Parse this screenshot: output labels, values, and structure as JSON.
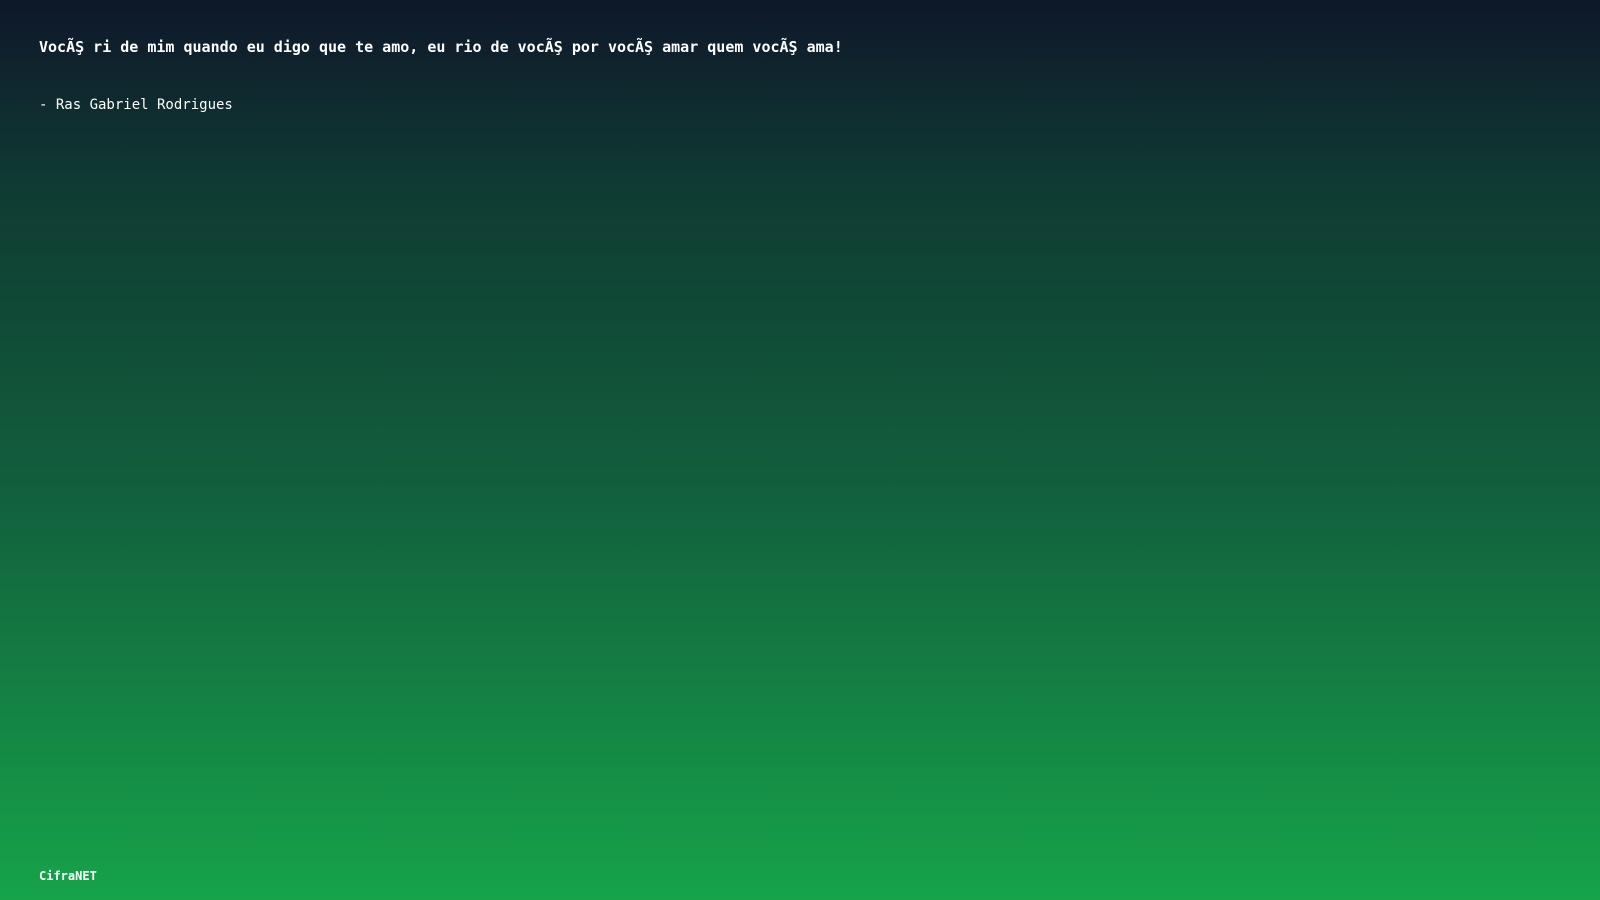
{
  "quote": {
    "text": "VocÃŞ ri de mim quando eu digo que te amo, eu rio de vocÃŞ por vocÃŞ amar quem vocÃŞ ama!",
    "author": "- Ras Gabriel Rodrigues"
  },
  "brand": {
    "name": "CifraNET"
  },
  "colors": {
    "gradient_top": "#0f172a",
    "gradient_bottom": "#16a34a",
    "text": "#ffffff"
  }
}
